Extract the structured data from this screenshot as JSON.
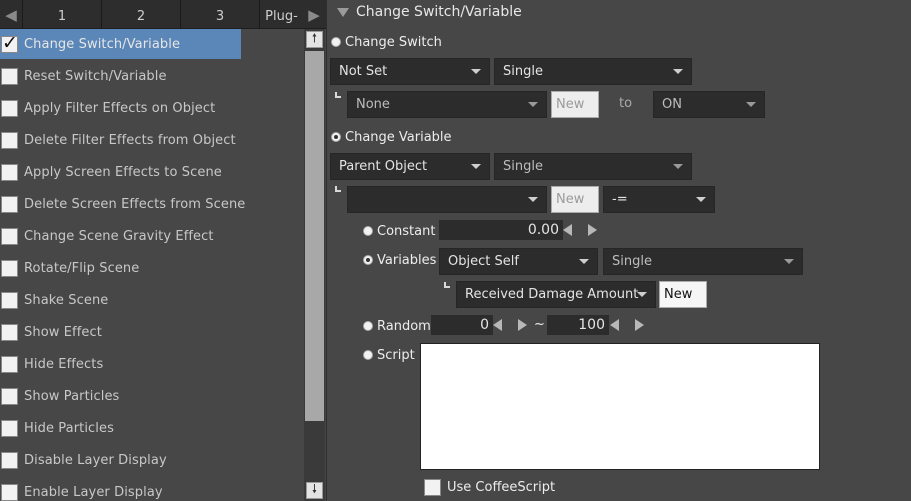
{
  "tabs": {
    "left_arrow": "◀",
    "right_arrow": "▶",
    "items": [
      "1",
      "2",
      "3",
      "Plug-"
    ]
  },
  "command_list": {
    "items": [
      {
        "label": "Change Switch/Variable",
        "selected": true
      },
      {
        "label": "Reset Switch/Variable",
        "selected": false
      },
      {
        "label": "Apply Filter Effects on Object",
        "selected": false
      },
      {
        "label": "Delete Filter Effects from Object",
        "selected": false
      },
      {
        "label": "Apply Screen Effects to Scene",
        "selected": false
      },
      {
        "label": "Delete Screen Effects from Scene",
        "selected": false
      },
      {
        "label": "Change Scene Gravity Effect",
        "selected": false
      },
      {
        "label": "Rotate/Flip Scene",
        "selected": false
      },
      {
        "label": "Shake Scene",
        "selected": false
      },
      {
        "label": "Show Effect",
        "selected": false
      },
      {
        "label": "Hide Effects",
        "selected": false
      },
      {
        "label": "Show Particles",
        "selected": false
      },
      {
        "label": "Hide Particles",
        "selected": false
      },
      {
        "label": "Disable Layer Display",
        "selected": false
      },
      {
        "label": "Enable Layer Display",
        "selected": false
      }
    ],
    "scroll_up": "🠕",
    "scroll_down": "🠗"
  },
  "panel": {
    "title": "Change Switch/Variable",
    "change_switch": {
      "label": "Change Switch",
      "selected": false,
      "object_dropdown": "Not Set",
      "scope_dropdown": "Single",
      "switch_dropdown": "None",
      "new_button": "New",
      "to_label": "to",
      "value_dropdown": "ON"
    },
    "change_variable": {
      "label": "Change Variable",
      "selected": true,
      "object_dropdown": "Parent Object",
      "scope_dropdown": "Single",
      "variable_dropdown": "",
      "new_button": "New",
      "operator_dropdown": "-=",
      "constant": {
        "label": "Constant",
        "selected": false,
        "value": "0.00"
      },
      "variables": {
        "label": "Variables",
        "selected": true,
        "object_dropdown": "Object Self",
        "scope_dropdown": "Single",
        "variable_dropdown": "Received Damage Amount",
        "new_button": "New"
      },
      "random": {
        "label": "Random",
        "selected": false,
        "min": "0",
        "separator": "~",
        "max": "100"
      },
      "script": {
        "label": "Script",
        "selected": false,
        "value": ""
      },
      "use_coffeescript": {
        "label": "Use CoffeeScript",
        "checked": false
      }
    }
  }
}
